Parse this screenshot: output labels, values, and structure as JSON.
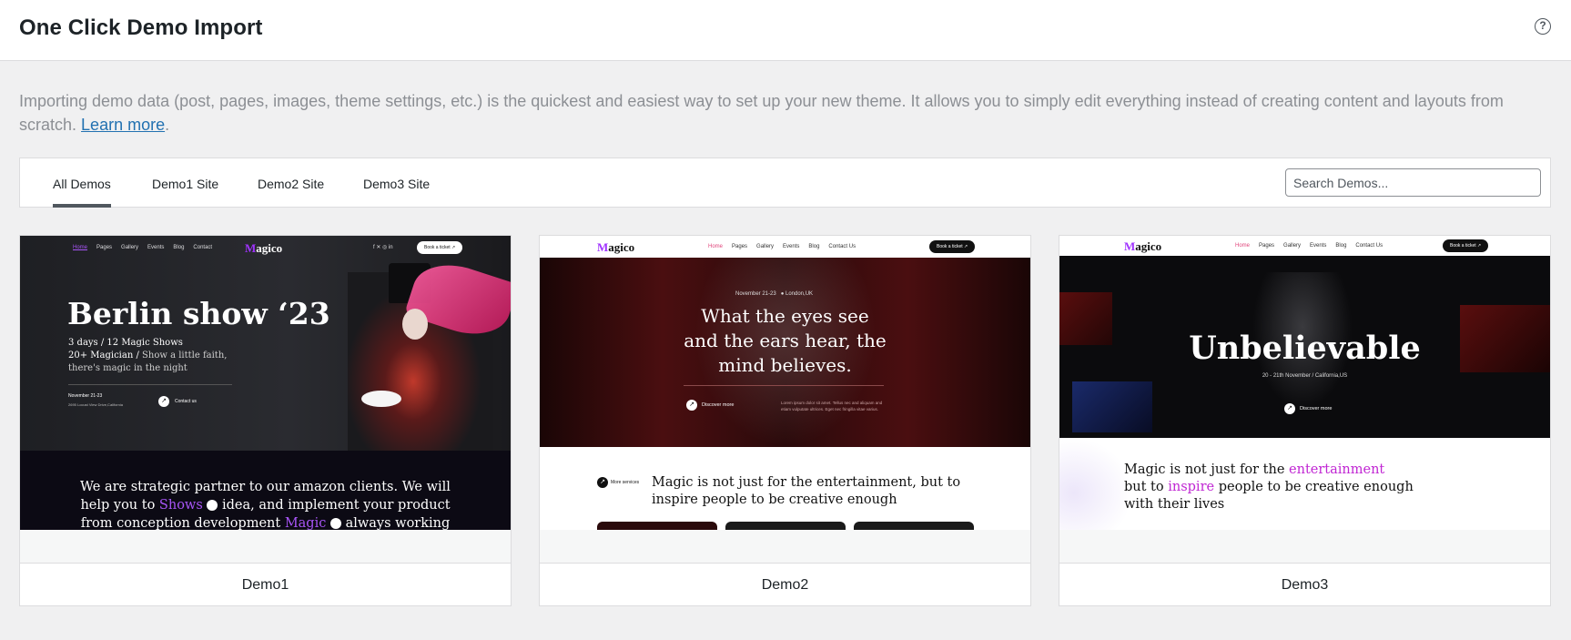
{
  "header": {
    "title": "One Click Demo Import",
    "help_icon": "question-circle-icon"
  },
  "intro": {
    "text": "Importing demo data (post, pages, images, theme settings, etc.) is the quickest and easiest way to set up your new theme. It allows you to simply edit everything instead of creating content and layouts from scratch.",
    "link": "Learn more",
    "end": "."
  },
  "tabs": [
    {
      "label": "All Demos",
      "active": true
    },
    {
      "label": "Demo1 Site",
      "active": false
    },
    {
      "label": "Demo2 Site",
      "active": false
    },
    {
      "label": "Demo3 Site",
      "active": false
    }
  ],
  "search": {
    "placeholder": "Search Demos..."
  },
  "demos": [
    {
      "name": "Demo1",
      "preview": {
        "nav": [
          "Home",
          "Pages",
          "Gallery",
          "Events",
          "Blog",
          "Contact"
        ],
        "logo_first": "M",
        "logo_rest": "agico",
        "social": "f  ✕  ◎  in",
        "ticket": "Book a ticket ↗",
        "headline": "Berlin show ‘23",
        "line1": "3 days / 12 Magic Shows",
        "line2a": "20+ Magician /",
        "line2b": "Show a little faith,",
        "line3": "there's magic in the night",
        "date": "November 21-23",
        "address": "2695 Locust View Drive,California",
        "contact": "Contact us",
        "body1": "We are strategic partner to our amazon clients. We will",
        "body2a": "help you to",
        "body2b": "Shows",
        "body2c": "idea, and implement your product",
        "body3a": "from conception development",
        "body3b": "Magic",
        "body3c": "always working"
      }
    },
    {
      "name": "Demo2",
      "preview": {
        "logo_first": "M",
        "logo_rest": "agico",
        "nav": [
          "Home",
          "Pages",
          "Gallery",
          "Events",
          "Blog",
          "Contact Us"
        ],
        "ticket": "Book a ticket ↗",
        "meta_date": "November 21-23",
        "meta_loc": "London,UK",
        "headline1": "What the eyes see",
        "headline2": "and the ears hear, the",
        "headline3": "mind believes.",
        "discover": "Discover more",
        "desc1": "Lorem ipsum dolor sit amet. Tellus nec and aliquam and",
        "desc2": "etiam vulputate ultrices. Eget nec fringilla vitae varius.",
        "services": "More services",
        "body1": "Magic is not just for the entertainment, but to",
        "body2": "inspire people to be creative enough"
      }
    },
    {
      "name": "Demo3",
      "preview": {
        "logo_first": "M",
        "logo_rest": "agico",
        "nav": [
          "Home",
          "Pages",
          "Gallery",
          "Events",
          "Blog",
          "Contact Us"
        ],
        "ticket": "Book a ticket ↗",
        "headline": "Unbelievable",
        "sub": "20 - 21th November / California,US",
        "discover": "Discover more",
        "body1a": "Magic is not just for the",
        "body1b": "entertainment",
        "body2a": "but to",
        "body2b": "inspire",
        "body2c": "people to be creative enough",
        "body3": "with their lives"
      }
    }
  ]
}
